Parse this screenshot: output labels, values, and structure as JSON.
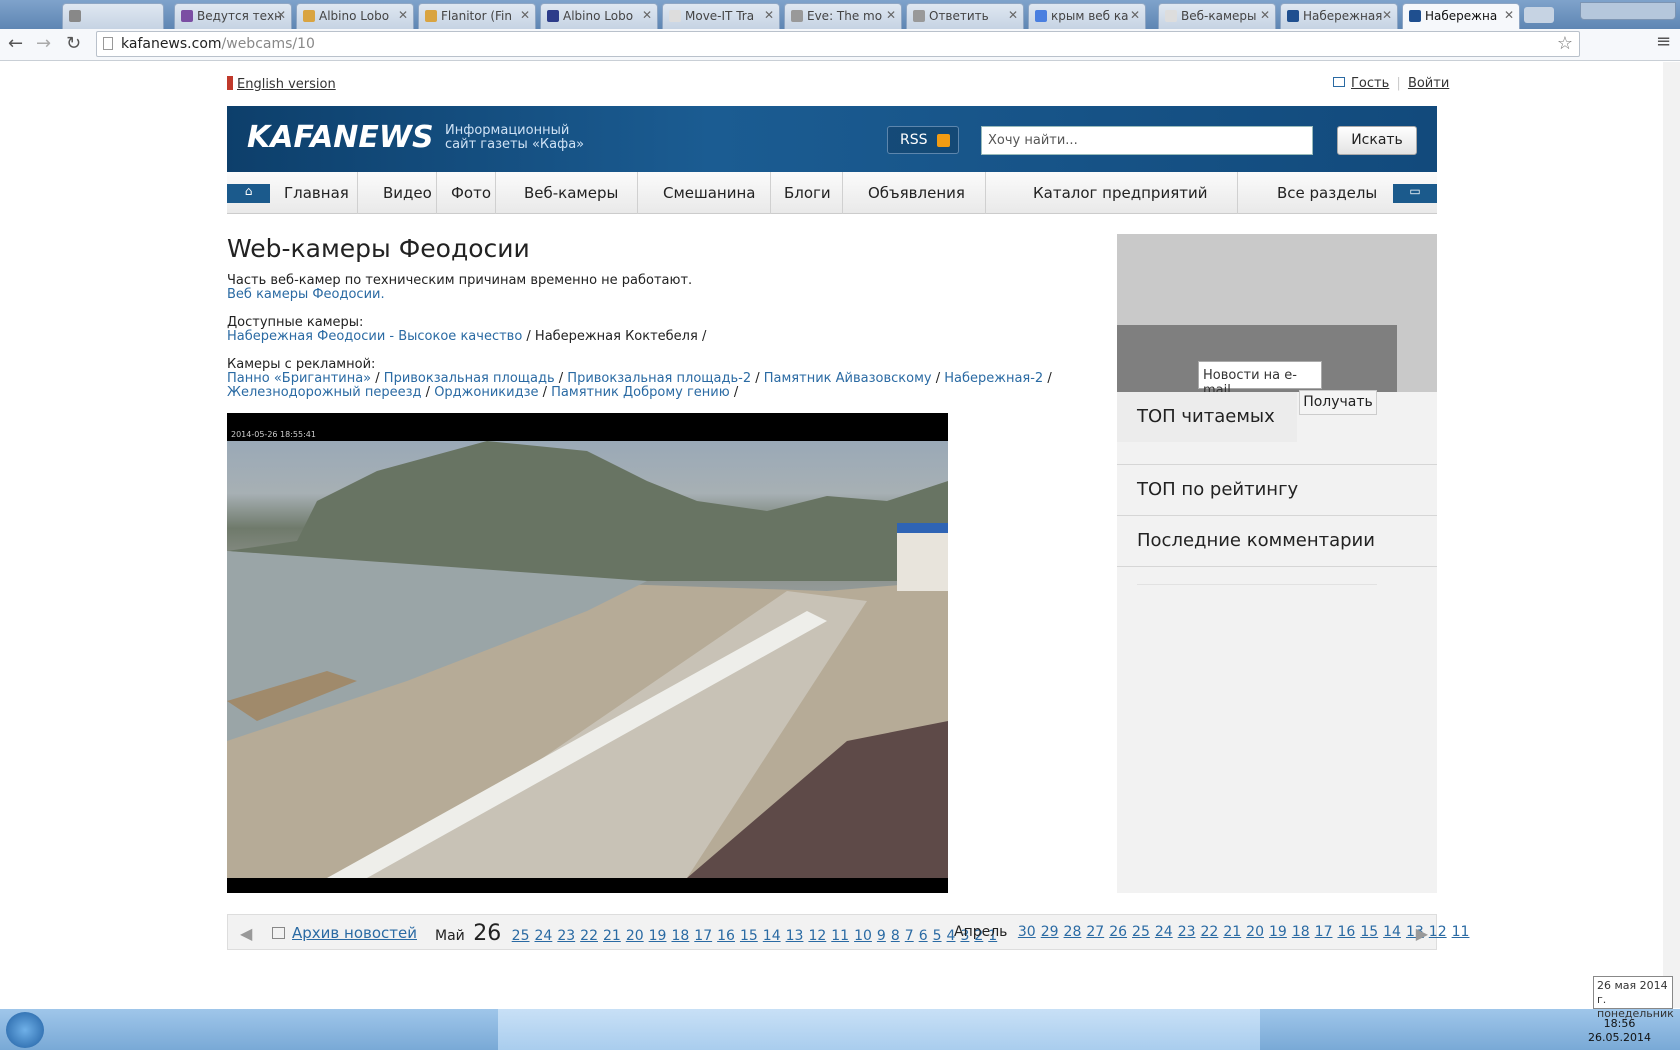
{
  "browser": {
    "tabs": [
      {
        "label": ""
      },
      {
        "label": "Ведутся техн"
      },
      {
        "label": "Albino Lobo"
      },
      {
        "label": "Flanitor (Fin"
      },
      {
        "label": "Albino Lobo"
      },
      {
        "label": "Move-IT Tra"
      },
      {
        "label": "Eve: The mo"
      },
      {
        "label": "Ответить"
      },
      {
        "label": "крым веб ка"
      },
      {
        "label": "Веб-камеры"
      },
      {
        "label": "Набережная"
      },
      {
        "label": "Набережна"
      }
    ],
    "url_host": "kafanews.com",
    "url_path": "/webcams/10"
  },
  "utility": {
    "english": "English version",
    "guest": "Гость",
    "login": "Войти"
  },
  "header": {
    "logo": "KAFANEWS",
    "tagline1": "Информационный",
    "tagline2": "сайт газеты «Кафа»",
    "rss": "RSS",
    "search_placeholder": "Хочу найти...",
    "search_button": "Искать"
  },
  "nav": {
    "items": [
      "Главная",
      "Видео",
      "Фото",
      "Веб-камеры",
      "Смешанина",
      "Блоги",
      "Объявления",
      "Каталог предприятий",
      "Все разделы"
    ]
  },
  "main": {
    "title": "Web-камеры Феодосии",
    "notice": "Часть веб-камер по техническим причинам временно не работают.",
    "notice_link": "Веб камеры Феодосии.",
    "available_label": "Доступные камеры:",
    "available_link": "Набережная Феодосии - Высокое качество",
    "available_current": " / Набережная Коктебеля /",
    "ads_label": "Камеры с рекламной:",
    "ads_links": [
      "Панно «Бригантина»",
      "Привокзальная площадь",
      "Привокзальная площадь-2",
      "Памятник Айвазовскому",
      "Набережная-2",
      "Железнодорожный переезд",
      "Орджоникидзе",
      "Памятник Доброму гению"
    ],
    "cam_timestamp": "2014-05-26 18:55:41"
  },
  "sidebar": {
    "email_placeholder": "Новости на e-mail",
    "get_button": "Получать",
    "top_read": "ТОП читаемых",
    "top_rating": "ТОП по рейтингу",
    "last_comments": "Последние комментарии"
  },
  "archive": {
    "link": "Архив новостей",
    "month1": "Май",
    "current_day": "26",
    "days1": [
      "25",
      "24",
      "23",
      "22",
      "21",
      "20",
      "19",
      "18",
      "17",
      "16",
      "15",
      "14",
      "13",
      "12",
      "11",
      "10",
      "9",
      "8",
      "7",
      "6",
      "5",
      "4",
      "3",
      "2",
      "1"
    ],
    "month2": "Апрель",
    "days2": [
      "30",
      "29",
      "28",
      "27",
      "26",
      "25",
      "24",
      "23",
      "22",
      "21",
      "20",
      "19",
      "18",
      "17",
      "16",
      "15",
      "14",
      "13",
      "12",
      "11"
    ]
  },
  "taskbar": {
    "time": "18:56",
    "date": "26.05.2014",
    "tooltip_line1": "26 мая 2014 г.",
    "tooltip_line2": "понедельник"
  }
}
